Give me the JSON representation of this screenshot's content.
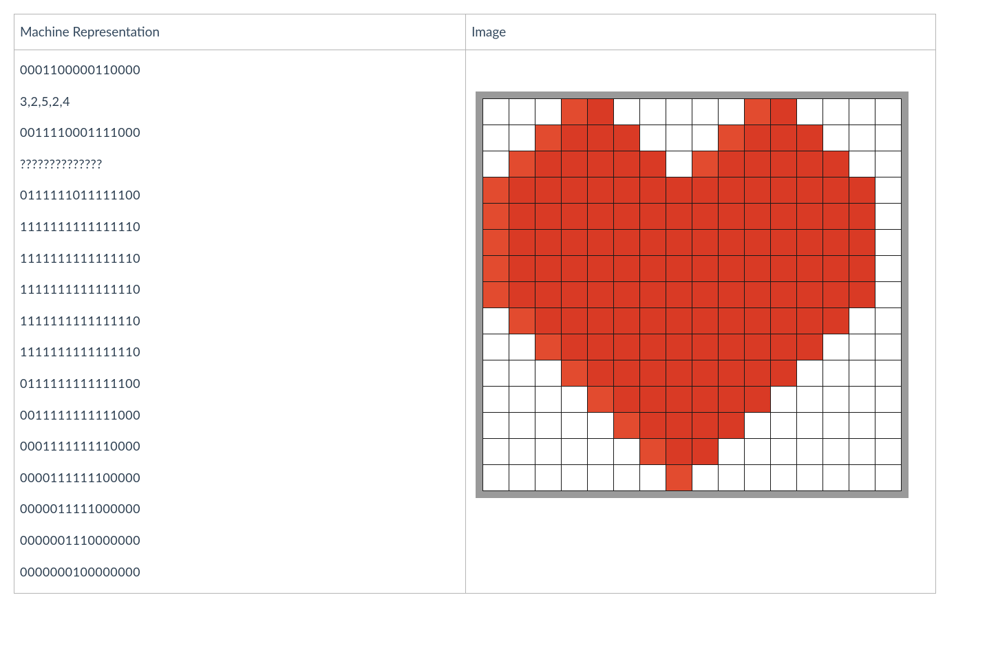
{
  "headers": {
    "representation": "Machine Representation",
    "image": "Image"
  },
  "representation_lines": [
    "0001100000110000",
    "3,2,5,2,4",
    "0011110001111000",
    "??????????????",
    "0111111011111100",
    "1111111111111110",
    "1111111111111110",
    "1111111111111110",
    "1111111111111110",
    "1111111111111110",
    "0111111111111100",
    "0011111111111000",
    "0001111111110000",
    "0000111111100000",
    "0000011111000000",
    "0000001110000000",
    "0000000100000000"
  ],
  "pixel_rows": [
    "0001100000110000",
    "0011110001111000",
    "0111111011111100",
    "1111111111111110",
    "1111111111111110",
    "1111111111111110",
    "1111111111111110",
    "1111111111111110",
    "0111111111111100",
    "0011111111111000",
    "0001111111110000",
    "0000111111100000",
    "0000011111000000",
    "0000001110000000",
    "0000000100000000"
  ],
  "colors": {
    "on": "#d93a25",
    "edge": "#e24b2f",
    "off": "#ffffff",
    "frame": "#9a9a9a",
    "gridline": "#1a1a1a"
  }
}
